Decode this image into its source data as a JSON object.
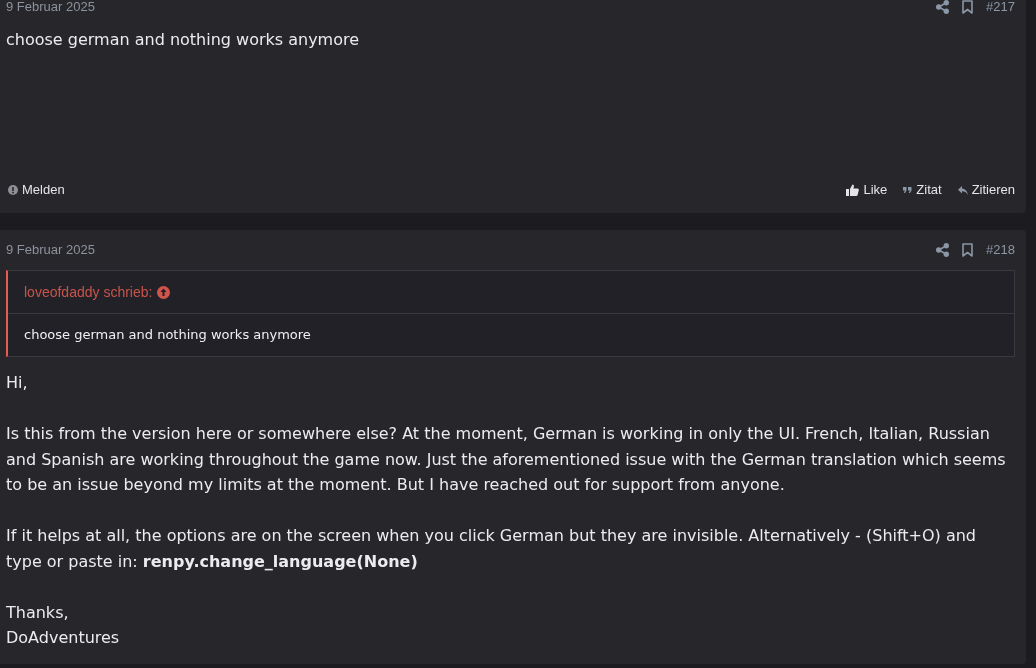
{
  "posts": [
    {
      "date": "9 Februar 2025",
      "number": "#217",
      "body": [
        {
          "kind": "paragraph",
          "lines": [
            "choose german and nothing works anymore"
          ]
        }
      ],
      "actions_left": [
        {
          "kind": "report",
          "label": "Melden"
        }
      ],
      "actions_right": [
        {
          "kind": "like",
          "label": "Like"
        },
        {
          "kind": "quote",
          "label": "Zitat"
        },
        {
          "kind": "reply",
          "label": "Zitieren"
        }
      ]
    },
    {
      "date": "9 Februar 2025",
      "number": "#218",
      "body": [
        {
          "kind": "quote",
          "author": "loveofdaddy schrieb:",
          "text": "choose german and nothing works anymore"
        },
        {
          "kind": "paragraph",
          "lines": [
            "Hi,"
          ]
        },
        {
          "kind": "paragraph",
          "lines": [
            "Is this from the version here or somewhere else? At the moment, German is working in only the UI. French, Italian, Russian and Spanish are working throughout the game now. Just the aforementioned issue with the German translation which seems to be an issue beyond my limits at the moment. But I have reached out for support from anyone."
          ]
        },
        {
          "kind": "paragraph",
          "lines": [
            "If it helps at all, the options are on the screen when you click German but they are invisible. Alternatively - (Shift+O) and type or paste in: **renpy.change_language(None)**"
          ]
        },
        {
          "kind": "paragraph",
          "lines": [
            "Thanks,",
            "DoAdventures"
          ]
        }
      ]
    }
  ]
}
